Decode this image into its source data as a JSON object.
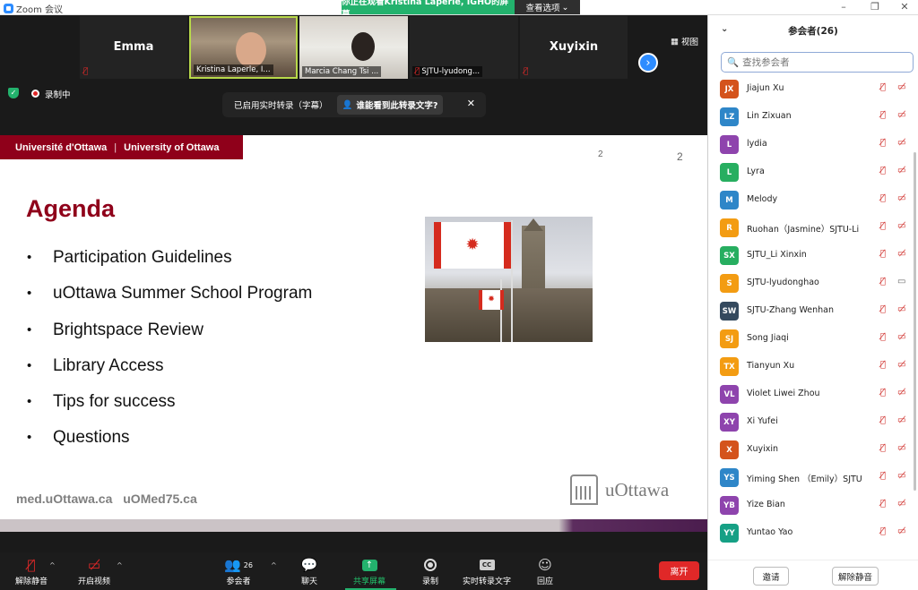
{
  "window": {
    "title": "Zoom 会议",
    "share_banner": "你正在观看Kristina Laperle, IGHO的屏幕",
    "view_options": "查看选项",
    "controls": [
      "–",
      "❐",
      "✕"
    ]
  },
  "thumbnails": [
    {
      "name": "Emma",
      "label": "",
      "muted": true,
      "video": false
    },
    {
      "name": "",
      "label": "Kristina Laperle, I...",
      "muted": false,
      "video": true
    },
    {
      "name": "",
      "label": "Marcia Chang Tsi ...",
      "muted": false,
      "video": true
    },
    {
      "name": "",
      "label": "SJTU-lyudong...",
      "muted": true,
      "video": false
    },
    {
      "name": "Xuyixin",
      "label": "",
      "muted": true,
      "video": false
    }
  ],
  "view_button": "视图",
  "status": {
    "recording": "录制中",
    "caption_notice": "已启用实时转录（字幕）",
    "caption_who": "谁能看到此转录文字?"
  },
  "slide": {
    "header_fr": "Université d'Ottawa",
    "header_sep": "|",
    "header_en": "University of Ottawa",
    "page_small": "2",
    "page_large": "2",
    "title": "Agenda",
    "bullet": "•",
    "items": [
      "Participation Guidelines",
      "uOttawa Summer School Program",
      "Brightspace Review",
      "Library Access",
      "Tips for success",
      "Questions"
    ],
    "footer_left": "med.uOttawa.ca uOMed75.ca",
    "logo_text": "uOttawa"
  },
  "toolbar": {
    "unmute": "解除静音",
    "start_video": "开启视频",
    "participants": "参会者",
    "participants_count": "26",
    "chat": "聊天",
    "share_screen": "共享屏幕",
    "record": "录制",
    "live_transcript": "实时转录文字",
    "reactions": "回应",
    "leave": "离开",
    "cc": "CC"
  },
  "panel": {
    "title": "参会者(26)",
    "search_placeholder": "查找参会者",
    "invite": "邀请",
    "unmute_all": "解除静音",
    "participants": [
      {
        "initials": "JX",
        "name": "Jiajun Xu",
        "color": "#d4531c",
        "cam": "off"
      },
      {
        "initials": "LZ",
        "name": "Lin Zixuan",
        "color": "#2e86c8",
        "cam": "off"
      },
      {
        "initials": "L",
        "name": "lydia",
        "color": "#8e44ad",
        "cam": "off"
      },
      {
        "initials": "L",
        "name": "Lyra",
        "color": "#27ae60",
        "cam": "off"
      },
      {
        "initials": "M",
        "name": "Melody",
        "color": "#2e86c8",
        "cam": "off"
      },
      {
        "initials": "R",
        "name": "Ruohan（Jasmine）SJTU-Li",
        "color": "#f39c12",
        "cam": "off"
      },
      {
        "initials": "SX",
        "name": "SJTU_Li Xinxin",
        "color": "#27ae60",
        "cam": "off"
      },
      {
        "initials": "S",
        "name": "SJTU-lyudonghao",
        "color": "#f39c12",
        "cam": "on"
      },
      {
        "initials": "SW",
        "name": "SJTU-Zhang Wenhan",
        "color": "#34495e",
        "cam": "off"
      },
      {
        "initials": "SJ",
        "name": "Song Jiaqi",
        "color": "#f39c12",
        "cam": "off"
      },
      {
        "initials": "TX",
        "name": "Tianyun Xu",
        "color": "#f39c12",
        "cam": "off"
      },
      {
        "initials": "VL",
        "name": "Violet Liwei Zhou",
        "color": "#8e44ad",
        "cam": "off"
      },
      {
        "initials": "XY",
        "name": "Xi Yufei",
        "color": "#8e44ad",
        "cam": "off"
      },
      {
        "initials": "X",
        "name": "Xuyixin",
        "color": "#d4531c",
        "cam": "off"
      },
      {
        "initials": "YS",
        "name": "Yiming Shen （Emily）SJTU",
        "color": "#2e86c8",
        "cam": "off"
      },
      {
        "initials": "YB",
        "name": "Yize Bian",
        "color": "#8e44ad",
        "cam": "off"
      },
      {
        "initials": "YY",
        "name": "Yuntao Yao",
        "color": "#16a085",
        "cam": "off"
      }
    ]
  },
  "colors": {
    "accent": "#2d8cff",
    "uottawa_red": "#8f001a",
    "share_green": "#23b26d",
    "leave_red": "#e02828"
  }
}
